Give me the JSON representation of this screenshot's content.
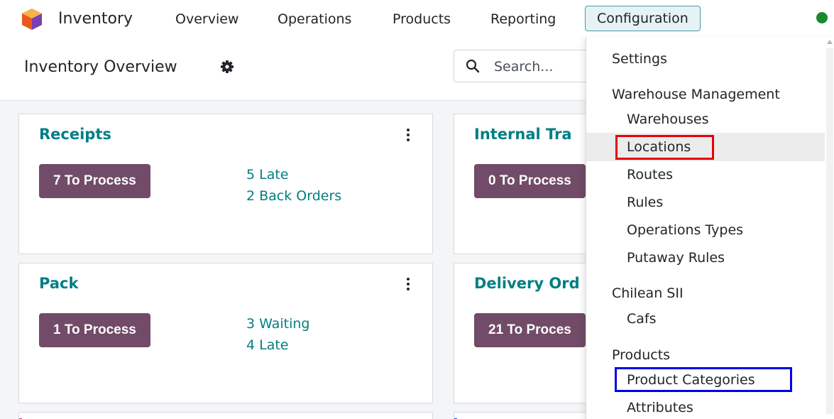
{
  "navbar": {
    "app_name": "Inventory",
    "items": [
      "Overview",
      "Operations",
      "Products",
      "Reporting"
    ],
    "active_item": "Configuration",
    "status_color": "#1b8a2e"
  },
  "control": {
    "title": "Inventory Overview",
    "search_placeholder": "Search..."
  },
  "cards": [
    {
      "title": "Receipts",
      "button": "7 To Process",
      "stats": [
        "5 Late",
        "2 Back Orders"
      ]
    },
    {
      "title": "Internal Tra",
      "button": "0 To Process",
      "stats": []
    },
    {
      "title": "Pack",
      "button": "1 To Process",
      "stats": [
        "3 Waiting",
        "4 Late"
      ]
    },
    {
      "title": "Delivery Ord",
      "button": "21 To Proces",
      "stats": []
    }
  ],
  "dropdown": {
    "settings": "Settings",
    "warehouse_header": "Warehouse Management",
    "warehouse_items": [
      "Warehouses",
      "Locations",
      "Routes",
      "Rules",
      "Operations Types",
      "Putaway Rules"
    ],
    "chilean_header": "Chilean SII",
    "chilean_items": [
      "Cafs"
    ],
    "products_header": "Products",
    "products_items": [
      "Product Categories",
      "Attributes"
    ]
  },
  "colors": {
    "accent": "#017e84",
    "button": "#714b67",
    "highlight_red": "#e8000b",
    "highlight_blue": "#0000e6"
  }
}
